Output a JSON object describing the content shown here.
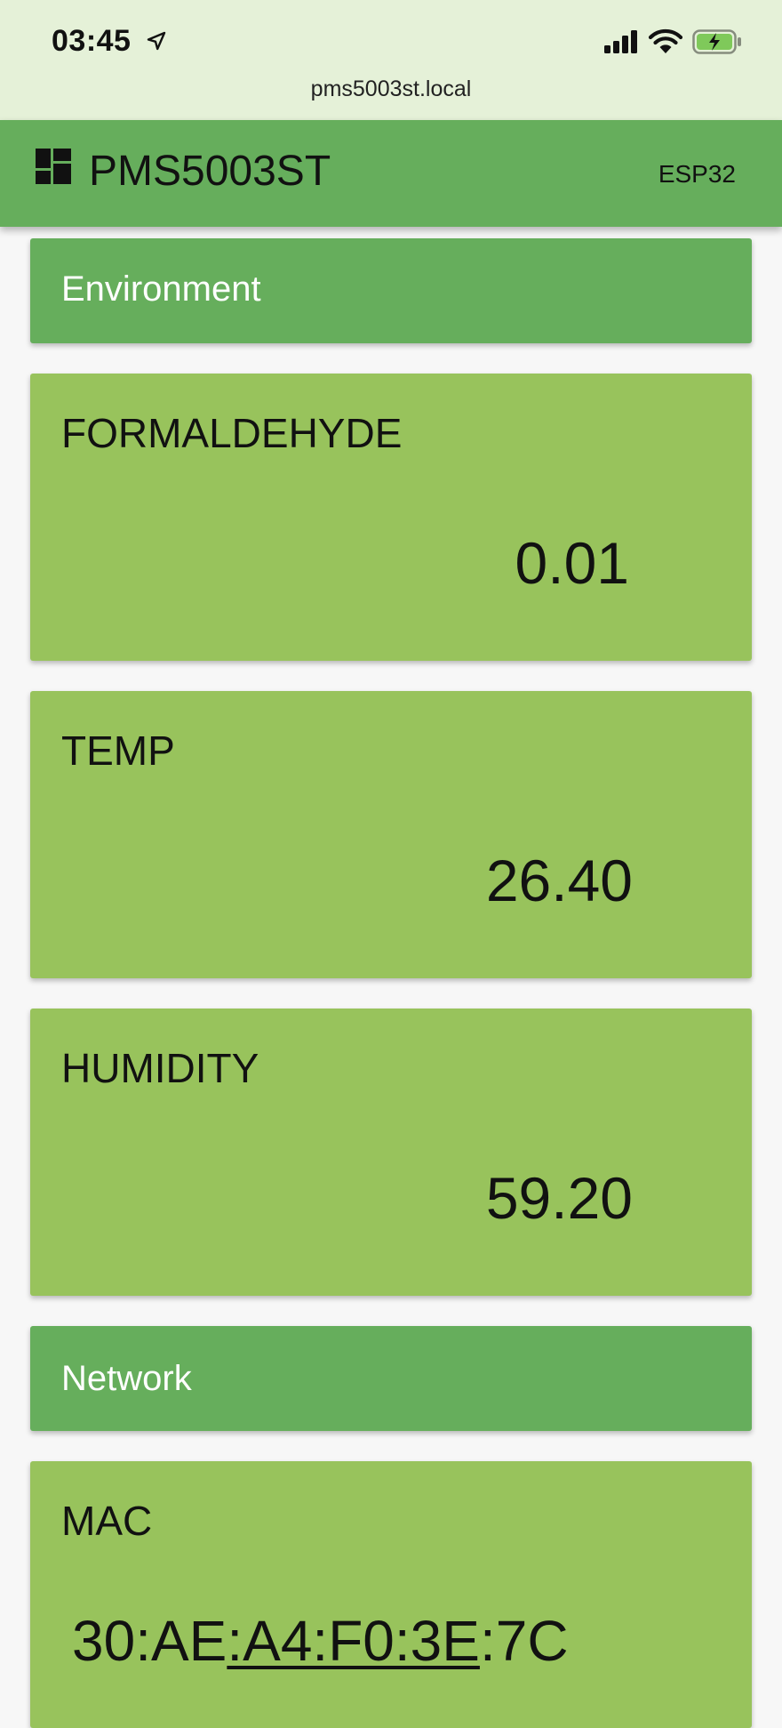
{
  "status_bar": {
    "time": "03:45",
    "url": "pms5003st.local",
    "colors": {
      "background": "#e5f1d8",
      "battery": "#7fc95a"
    }
  },
  "header": {
    "title": "PMS5003ST",
    "device": "ESP32",
    "icon": "dashboard-icon",
    "colors": {
      "background": "#66ae5c"
    }
  },
  "sections": {
    "environment": {
      "title": "Environment",
      "cards": [
        {
          "label": "FORMALDEHYDE",
          "value": "0.01"
        },
        {
          "label": "TEMP",
          "value": "26.40"
        },
        {
          "label": "HUMIDITY",
          "value": "59.20"
        }
      ]
    },
    "network": {
      "title": "Network",
      "mac": {
        "label": "MAC",
        "value_prefix": "30:AE",
        "value_link": ":A4:F0:3E",
        "value_suffix": ":7C"
      }
    }
  },
  "colors": {
    "group_header": "#66ae5c",
    "card": "#98c35c",
    "page_background": "#f7f7f7"
  }
}
